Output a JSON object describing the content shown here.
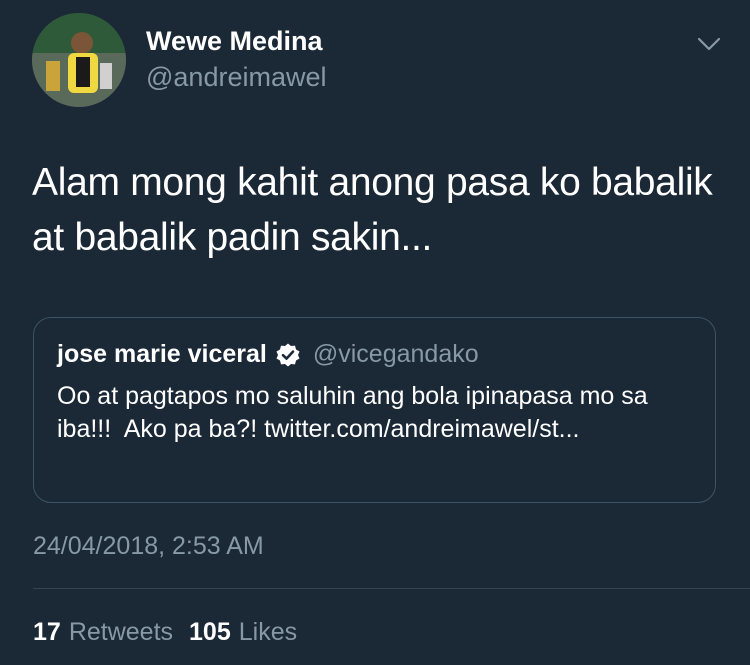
{
  "author": {
    "name": "Wewe Medina",
    "handle": "@andreimawel",
    "avatar_icon": "profile-photo-avatar"
  },
  "menu_icon": "chevron-down-icon",
  "tweet": {
    "text": "Alam mong kahit anong pasa ko babalik at babalik padin sakin..."
  },
  "quoted_tweet": {
    "name": "jose marie viceral",
    "verified_icon": "verified-badge-icon",
    "handle": "@vicegandako",
    "text": "Oo at pagtapos mo saluhin ang bola ipinapasa mo sa iba!!!  Ako pa ba?! twitter.com/andreimawel/st..."
  },
  "timestamp": "24/04/2018, 2:53 AM",
  "stats": {
    "retweets_count": "17",
    "retweets_label": "Retweets",
    "likes_count": "105",
    "likes_label": "Likes"
  },
  "colors": {
    "background": "#1b2836",
    "primary_text": "#ffffff",
    "secondary_text": "#8899a6",
    "border": "#3d5466"
  }
}
